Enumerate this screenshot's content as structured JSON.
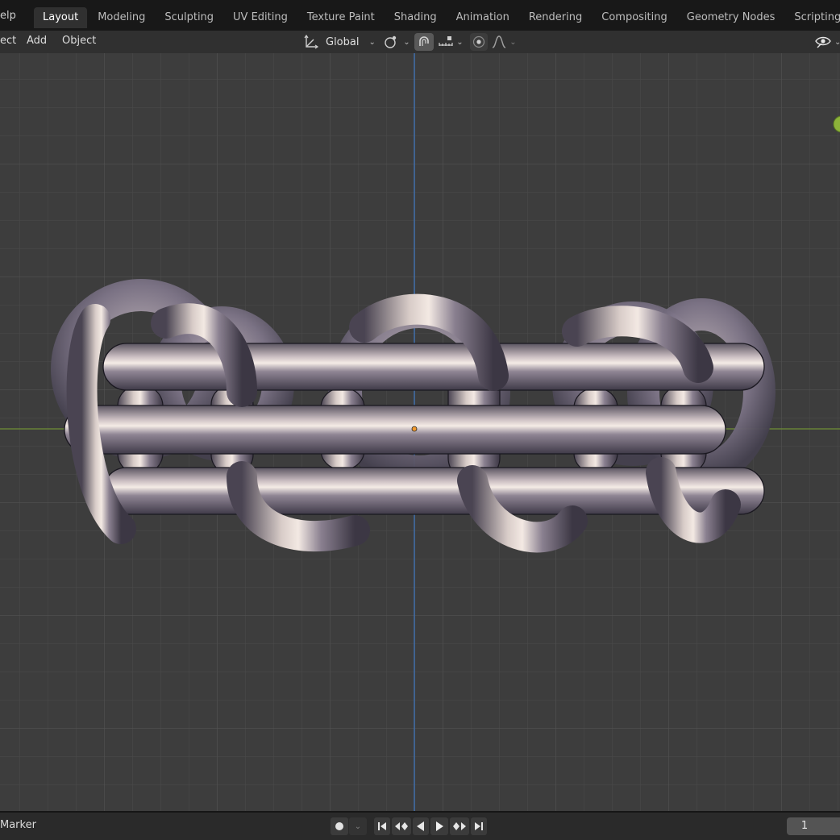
{
  "topbar": {
    "menu_fragment": "elp",
    "tabs": [
      {
        "label": "Layout",
        "active": true
      },
      {
        "label": "Modeling"
      },
      {
        "label": "Sculpting"
      },
      {
        "label": "UV Editing"
      },
      {
        "label": "Texture Paint"
      },
      {
        "label": "Shading"
      },
      {
        "label": "Animation"
      },
      {
        "label": "Rendering"
      },
      {
        "label": "Compositing"
      },
      {
        "label": "Geometry Nodes"
      },
      {
        "label": "Scripting"
      }
    ]
  },
  "viewport_header": {
    "menus": {
      "select_fragment": "ect",
      "add": "Add",
      "object": "Object"
    },
    "transform_orientation": "Global",
    "icons": [
      "orientation-icon",
      "pivot-icon",
      "snap-magnet-icon",
      "snap-increment-icon",
      "proportional-edit-icon",
      "falloff-icon",
      "visibility-icon"
    ]
  },
  "colors": {
    "viewport_bg": "#3d3d3d",
    "grid": "#4c4c4c",
    "x_axis": "#7a9a3a",
    "y_axis": "#3f6fb0",
    "active_tab": "#303030"
  },
  "timeline": {
    "marker_label": "Marker",
    "current_frame": "1",
    "icons": [
      "record-icon",
      "jump-start-icon",
      "prev-keyframe-icon",
      "play-reverse-icon",
      "play-icon",
      "next-keyframe-icon",
      "jump-end-icon"
    ]
  }
}
